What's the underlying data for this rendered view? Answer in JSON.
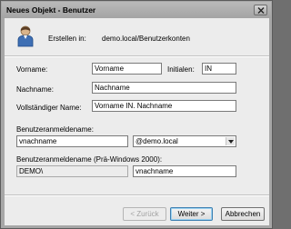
{
  "window": {
    "title": "Neues Objekt - Benutzer"
  },
  "header": {
    "created_in_label": "Erstellen in:",
    "container_path": "demo.local/Benutzerkonten",
    "icon": "user-icon"
  },
  "form": {
    "vorname_label": "Vorname:",
    "vorname_value": "Vorname",
    "initialen_label": "Initialen:",
    "initialen_value": "IN",
    "nachname_label": "Nachname:",
    "nachname_value": "Nachname",
    "fullname_label": "Vollständiger Name:",
    "fullname_value": "Vorname IN. Nachname",
    "logon_label": "Benutzeranmeldename:",
    "logon_value": "vnachname",
    "domain_value": "@demo.local",
    "prewin_label": "Benutzeranmeldename (Prä-Windows 2000):",
    "prewin_domain": "DEMO\\",
    "prewin_value": "vnachname"
  },
  "buttons": {
    "back": "< Zurück",
    "next": "Weiter >",
    "cancel": "Abbrechen"
  }
}
